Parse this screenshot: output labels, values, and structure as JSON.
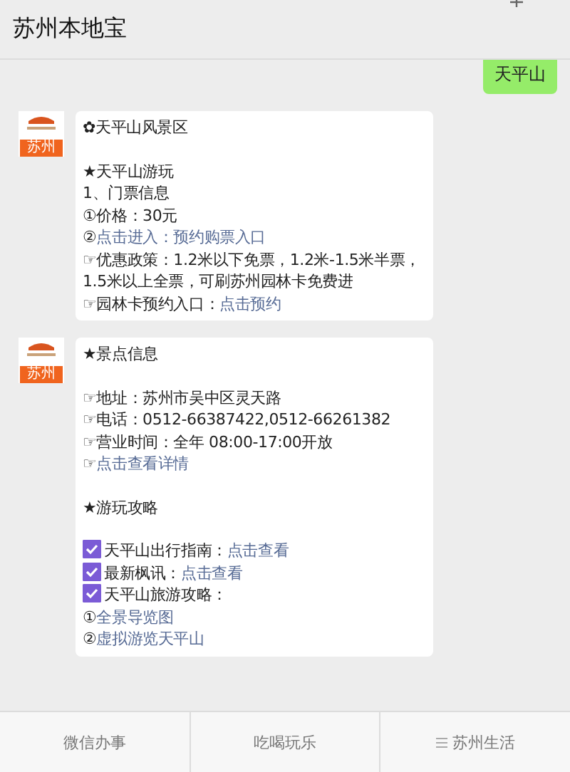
{
  "header": {
    "title": "苏州本地宝"
  },
  "messages": [
    {
      "kind": "sent",
      "text": "天平山"
    },
    {
      "kind": "received",
      "avatar": {
        "label": "苏州"
      },
      "paragraphs": [
        [
          {
            "kind": "text",
            "segments": [
              {
                "text": "✿天平山风景区",
                "link": false
              }
            ]
          }
        ],
        [
          {
            "kind": "text",
            "segments": [
              {
                "text": "★天平山游玩",
                "link": false
              }
            ]
          },
          {
            "kind": "text",
            "segments": [
              {
                "text": "1、门票信息",
                "link": false
              }
            ]
          },
          {
            "kind": "text",
            "segments": [
              {
                "text": "①价格：30元",
                "link": false
              }
            ]
          },
          {
            "kind": "text",
            "segments": [
              {
                "text": "②",
                "link": false
              },
              {
                "text": "点击进入：预约购票入口",
                "link": true
              }
            ]
          },
          {
            "kind": "text",
            "segments": [
              {
                "text": "☞优惠政策：1.2米以下免票，1.2米-1.5米半票，1.5米以上全票，可刷苏州园林卡免费进",
                "link": false
              }
            ]
          },
          {
            "kind": "text",
            "segments": [
              {
                "text": "☞园林卡预约入口：",
                "link": false
              },
              {
                "text": "点击预约",
                "link": true
              }
            ]
          }
        ]
      ]
    },
    {
      "kind": "received",
      "avatar": {
        "label": "苏州"
      },
      "paragraphs": [
        [
          {
            "kind": "text",
            "segments": [
              {
                "text": "★景点信息",
                "link": false
              }
            ]
          }
        ],
        [
          {
            "kind": "text",
            "segments": [
              {
                "text": "☞地址：苏州市吴中区灵天路",
                "link": false
              }
            ]
          },
          {
            "kind": "text",
            "segments": [
              {
                "text": "☞电话：0512-66387422,0512-66261382",
                "link": false
              }
            ]
          },
          {
            "kind": "text",
            "segments": [
              {
                "text": "☞营业时间：全年 08:00-17:00开放",
                "link": false
              }
            ]
          },
          {
            "kind": "text",
            "segments": [
              {
                "text": "☞",
                "link": false
              },
              {
                "text": "点击查看详情",
                "link": true
              }
            ]
          }
        ],
        [
          {
            "kind": "text",
            "segments": [
              {
                "text": "★游玩攻略",
                "link": false
              }
            ]
          }
        ],
        [
          {
            "kind": "check",
            "checked": true,
            "segments": [
              {
                "text": "天平山出行指南：",
                "link": false
              },
              {
                "text": "点击查看",
                "link": true
              }
            ]
          },
          {
            "kind": "check",
            "checked": true,
            "segments": [
              {
                "text": "最新枫讯：",
                "link": false
              },
              {
                "text": "点击查看",
                "link": true
              }
            ]
          },
          {
            "kind": "check",
            "checked": true,
            "segments": [
              {
                "text": "天平山旅游攻略：",
                "link": false
              }
            ]
          },
          {
            "kind": "text",
            "segments": [
              {
                "text": "①",
                "link": false
              },
              {
                "text": "全景导览图",
                "link": true
              }
            ]
          },
          {
            "kind": "text",
            "segments": [
              {
                "text": "②",
                "link": false
              },
              {
                "text": "虚拟游览天平山",
                "link": true
              }
            ]
          }
        ]
      ]
    }
  ],
  "menu": [
    {
      "label": "微信办事",
      "kind": "plain"
    },
    {
      "label": "吃喝玩乐",
      "kind": "plain"
    },
    {
      "label": "苏州生活",
      "kind": "submenu"
    }
  ]
}
